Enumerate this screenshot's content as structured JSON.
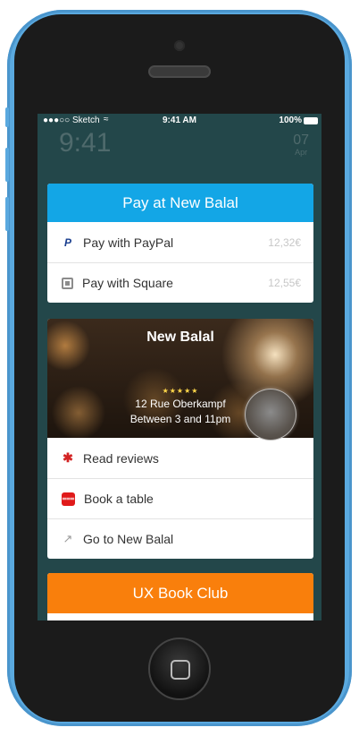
{
  "status_bar": {
    "carrier": "●●●○○ Sketch",
    "wifi_icon": "wifi-icon",
    "time": "9:41 AM",
    "battery": "100%"
  },
  "lock_screen": {
    "time": "9:41",
    "day": "07",
    "month": "Apr"
  },
  "pay_card": {
    "title": "Pay at New Balal",
    "header_color": "#13a6e6",
    "options": [
      {
        "icon": "paypal-icon",
        "label": "Pay with PayPal",
        "amount": "12,32€"
      },
      {
        "icon": "square-icon",
        "label": "Pay with Square",
        "amount": "12,55€"
      }
    ]
  },
  "place_card": {
    "title": "New Balal",
    "rating_stars": 5,
    "stars_text": "★★★★★",
    "address": "12 Rue Oberkampf",
    "hours": "Between 3 and 11pm",
    "actions": [
      {
        "icon": "yelp-icon",
        "label": "Read reviews"
      },
      {
        "icon": "table-reservation-icon",
        "label": "Book a table"
      },
      {
        "icon": "arrow-up-right-icon",
        "label": "Go to New Balal"
      }
    ]
  },
  "book_club_card": {
    "title": "UX Book Club",
    "header_color": "#f97f0c"
  }
}
